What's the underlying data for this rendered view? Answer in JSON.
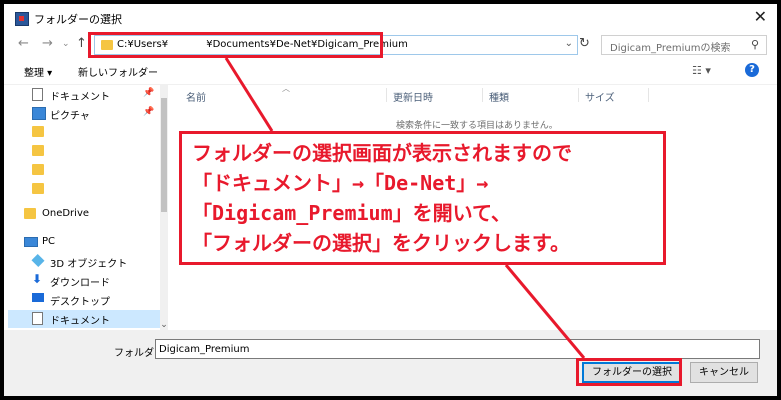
{
  "window": {
    "title": "フォルダーの選択"
  },
  "nav": {
    "address": "C:¥Users¥            ¥Documents¥De-Net¥Digicam_Premium",
    "search_placeholder": "Digicam_Premiumの検索"
  },
  "toolbar": {
    "organize": "整理 ▾",
    "new_folder": "新しいフォルダー"
  },
  "sidebar": {
    "items": [
      {
        "label": "ドキュメント",
        "icon": "document-icon",
        "pinned": true
      },
      {
        "label": "ピクチャ",
        "icon": "pictures-icon",
        "pinned": true
      },
      {
        "label": "",
        "icon": "folder-icon"
      },
      {
        "label": "",
        "icon": "folder-icon"
      },
      {
        "label": "",
        "icon": "folder-icon"
      },
      {
        "label": "",
        "icon": "folder-icon"
      },
      {
        "label": "OneDrive",
        "icon": "folder-icon"
      },
      {
        "label": "PC",
        "icon": "pc-icon"
      },
      {
        "label": "3D オブジェクト",
        "icon": "3d-objects-icon"
      },
      {
        "label": "ダウンロード",
        "icon": "download-icon"
      },
      {
        "label": "デスクトップ",
        "icon": "desktop-icon"
      },
      {
        "label": "ドキュメント",
        "icon": "document-icon",
        "selected": true
      }
    ]
  },
  "filelist": {
    "columns": [
      "名前",
      "更新日時",
      "種類",
      "サイズ"
    ],
    "empty_message": "検索条件に一致する項目はありません。"
  },
  "footer": {
    "folder_label": "フォルダー:",
    "folder_value": "Digicam_Premium",
    "select_button": "フォルダーの選択",
    "cancel_button": "キャンセル"
  },
  "annotation": {
    "lines": [
      "フォルダーの選択画面が表示されますので",
      "「ドキュメント」→「De-Net」→",
      "「Digicam_Premium」を開いて、",
      "「フォルダーの選択」をクリックします。"
    ],
    "color": "#e8192c"
  }
}
